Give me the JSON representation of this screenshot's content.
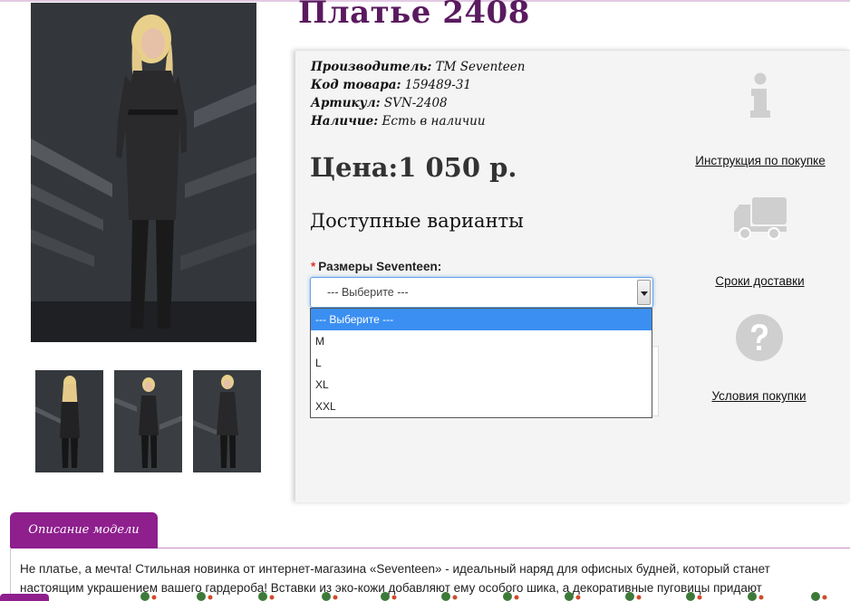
{
  "product": {
    "title": "Платье 2408",
    "details": [
      {
        "label": "Производитель:",
        "value": "TM Seventeen"
      },
      {
        "label": "Код товара:",
        "value": "159489-31"
      },
      {
        "label": "Артикул:",
        "value": "SVN-2408"
      },
      {
        "label": "Наличие:",
        "value": "Есть в наличии"
      }
    ],
    "price": "Цена:1 050 р.",
    "variants_title": "Доступные варианты"
  },
  "size_select": {
    "required_mark": "*",
    "label": "Размеры Seventeen:",
    "value": "--- Выберите ---",
    "options": [
      "--- Выберите ---",
      "M",
      "L",
      "XL",
      "XXL"
    ],
    "selected_index": 0
  },
  "side_info": {
    "instructions_label": "Инструкция по покупке",
    "delivery_label": "Сроки доставки",
    "terms_label": "Условия покупки",
    "icons": [
      "info-icon",
      "truck-icon",
      "question-icon"
    ]
  },
  "description": {
    "tab_label": "Описание модели",
    "text": "Не платье, а мечта! Стильная новинка от интернет-магазина «Seventeen» - идеальный наряд для офисных будней, который станет настоящим украшением вашего гардероба! Вставки из эко-кожи добавляют ему особого шика, а декоративные пуговицы придают"
  },
  "colors": {
    "title": "#5a1a5f",
    "accent": "#8e1f8d",
    "dropdown_highlight": "#3b8ff2",
    "icon_gray": "#cfcfcf"
  }
}
